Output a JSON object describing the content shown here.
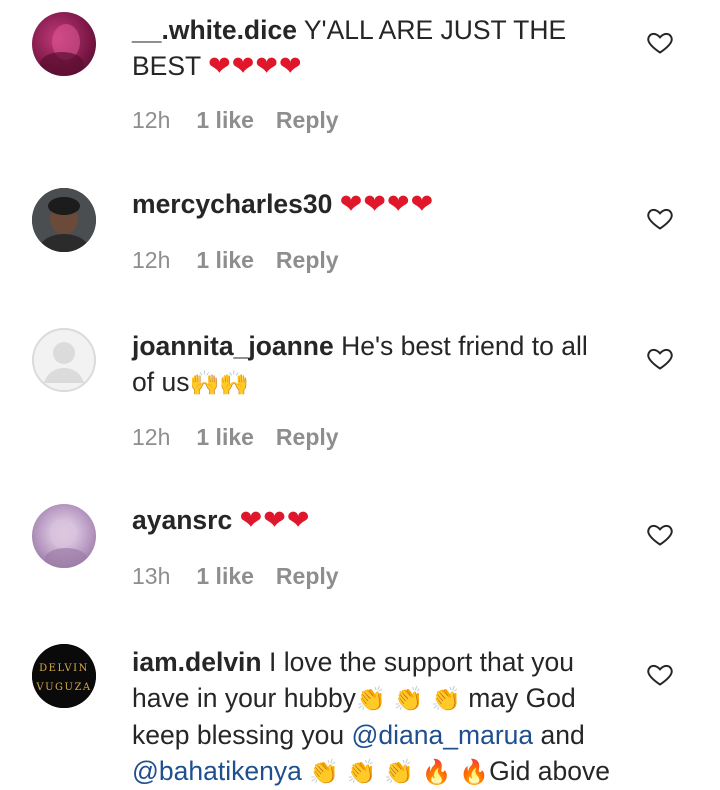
{
  "comments": [
    {
      "username": "__.white.dice",
      "text": "Y'ALL ARE JUST THE BEST",
      "emoji": "❤❤❤❤",
      "time": "12h",
      "likes": "1 like",
      "reply": "Reply",
      "avatar": "avatar-magenta"
    },
    {
      "username": "mercycharles30",
      "text": "",
      "emoji": "❤❤❤❤",
      "time": "12h",
      "likes": "1 like",
      "reply": "Reply",
      "avatar": "avatar-photo"
    },
    {
      "username": "joannita_joanne",
      "text": "He's best friend to all of us",
      "emoji": "🙌🙌",
      "time": "12h",
      "likes": "1 like",
      "reply": "Reply",
      "avatar": "avatar-default"
    },
    {
      "username": "ayansrc",
      "text": "",
      "emoji": "❤❤❤",
      "time": "13h",
      "likes": "1 like",
      "reply": "Reply",
      "avatar": "avatar-lilac"
    },
    {
      "username": "iam.delvin",
      "text_part1": "I love the support that you have in your hubby",
      "emoji1": "👏 👏 👏",
      "text_part2": "may God keep blessing you",
      "mention1": "@diana_marua",
      "text_part3": "and",
      "mention2": "@bahatikenya",
      "emoji2": "👏 👏 👏 🔥 🔥",
      "text_part4": "Gid above",
      "avatar": "avatar-delvin",
      "avatar_text_top": "DELVIN",
      "avatar_text_bottom": "VUGUZA"
    }
  ],
  "colors": {
    "emoji_heart": "#e0162b",
    "meta_grey": "#8e8e8e",
    "mention_blue": "#1e4f8f"
  }
}
